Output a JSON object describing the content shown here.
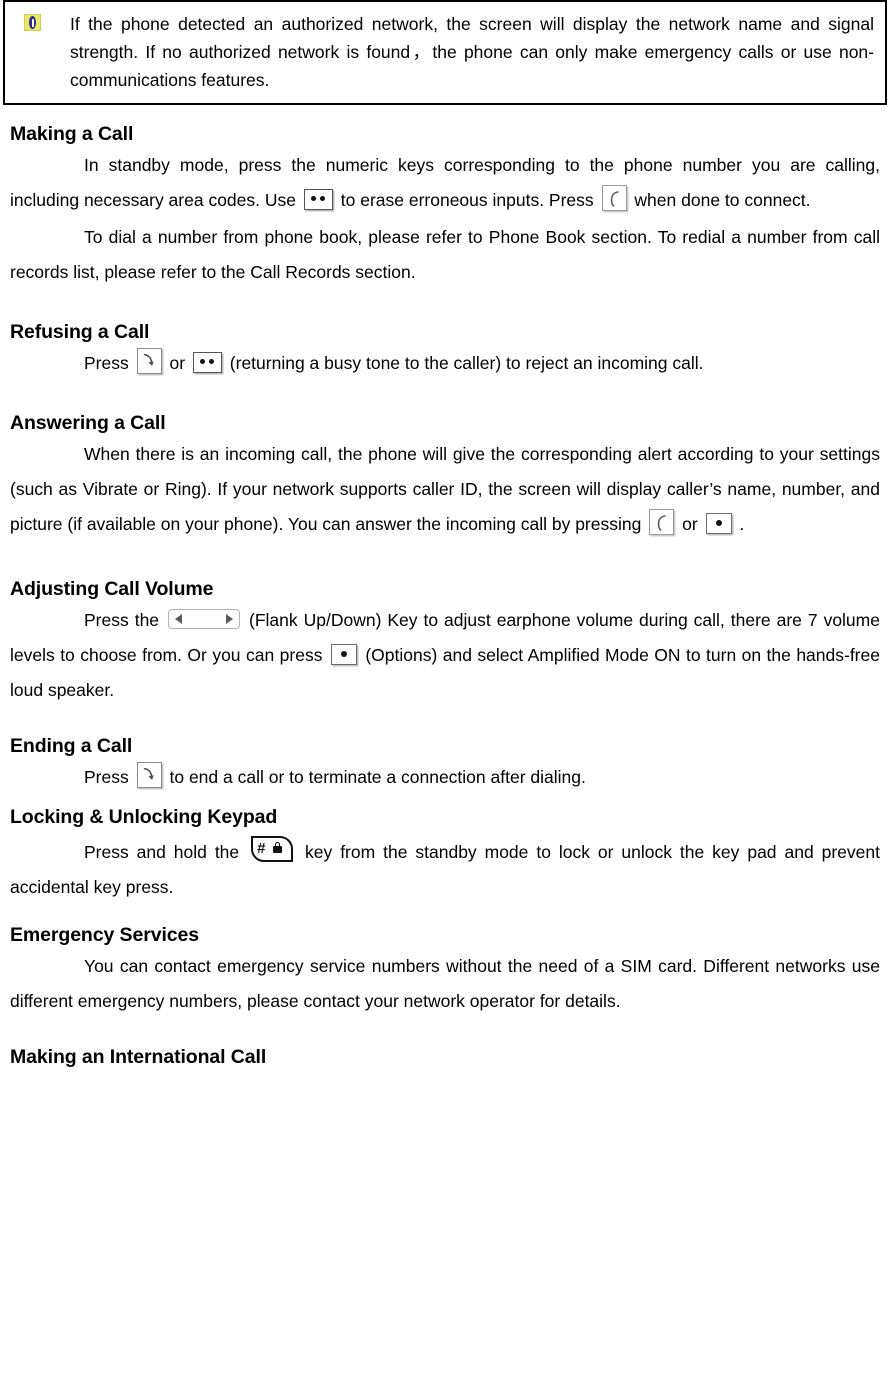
{
  "note": {
    "icon": "info-note-icon",
    "text": "If the phone detected an authorized network, the screen will display the network name and signal strength. If no authorized network is found，the phone can only make emergency calls or use non-communications features."
  },
  "sections": [
    {
      "id": "making-a-call",
      "title": "Making a Call",
      "paragraphs": [
        {
          "segments": [
            {
              "type": "text",
              "value": "In standby mode, press the numeric keys corresponding to the phone number you are calling, including necessary area codes. Use "
            },
            {
              "type": "icon",
              "value": "clear-key-icon"
            },
            {
              "type": "text",
              "value": " to erase erroneous inputs. Press "
            },
            {
              "type": "icon",
              "value": "send-key-icon"
            },
            {
              "type": "text",
              "value": " when done to connect."
            }
          ]
        },
        {
          "segments": [
            {
              "type": "text",
              "value": "To dial a number from phone book, please refer to Phone Book section. To redial a number from call records list, please refer to the Call Records section."
            }
          ]
        }
      ]
    },
    {
      "id": "refusing-a-call",
      "title": "Refusing a Call",
      "paragraphs": [
        {
          "segments": [
            {
              "type": "text",
              "value": "Press "
            },
            {
              "type": "icon",
              "value": "end-key-icon"
            },
            {
              "type": "text",
              "value": " or "
            },
            {
              "type": "icon",
              "value": "clear-key-icon"
            },
            {
              "type": "text",
              "value": " (returning a busy tone to the caller) to reject an incoming call."
            }
          ]
        }
      ]
    },
    {
      "id": "answering-a-call",
      "title": "Answering a Call",
      "paragraphs": [
        {
          "segments": [
            {
              "type": "text",
              "value": "When there is an incoming call, the phone will give the corresponding alert according to your settings (such as Vibrate or Ring). If your network supports caller ID, the screen will display caller’s name, number, and picture (if available on your phone). You can answer the incoming call by pressing "
            },
            {
              "type": "icon",
              "value": "send-key-icon"
            },
            {
              "type": "text",
              "value": " or "
            },
            {
              "type": "icon",
              "value": "soft-key-icon"
            },
            {
              "type": "text",
              "value": "."
            }
          ]
        }
      ]
    },
    {
      "id": "adjusting-call-volume",
      "title": "Adjusting Call Volume",
      "paragraphs": [
        {
          "segments": [
            {
              "type": "text",
              "value": "Press the "
            },
            {
              "type": "icon",
              "value": "flank-key-icon"
            },
            {
              "type": "text",
              "value": " (Flank Up/Down) Key to adjust earphone volume during call, there are 7 volume levels to choose from. Or you can press "
            },
            {
              "type": "icon",
              "value": "soft-key-icon"
            },
            {
              "type": "text",
              "value": " (Options) and select Amplified Mode ON to turn on the hands-free loud speaker."
            }
          ]
        }
      ]
    },
    {
      "id": "ending-a-call",
      "title": "Ending a Call",
      "paragraphs": [
        {
          "segments": [
            {
              "type": "text",
              "value": "Press "
            },
            {
              "type": "icon",
              "value": "end-key-icon"
            },
            {
              "type": "text",
              "value": " to end a call or to terminate a connection after dialing."
            }
          ]
        }
      ]
    },
    {
      "id": "locking-unlocking-keypad",
      "title": "Locking & Unlocking Keypad",
      "paragraphs": [
        {
          "segments": [
            {
              "type": "text",
              "value": "Press and hold the "
            },
            {
              "type": "icon",
              "value": "hash-lock-key-icon"
            },
            {
              "type": "text",
              "value": " key from the standby mode to lock or unlock the key pad and prevent accidental key press."
            }
          ]
        }
      ]
    },
    {
      "id": "emergency-services",
      "title": "Emergency Services",
      "paragraphs": [
        {
          "segments": [
            {
              "type": "text",
              "value": "You can contact emergency service numbers without the need of a SIM card. Different networks use different emergency numbers, please contact your network operator for details."
            }
          ]
        }
      ]
    },
    {
      "id": "making-an-international-call",
      "title": "Making an International Call",
      "paragraphs": []
    }
  ],
  "text": {
    "making_a_call_title": "Making a Call",
    "making_a_call_p1_a": "In standby mode, press the numeric keys corresponding to the phone number you are calling, including necessary area codes. Use",
    "making_a_call_p1_b": "to erase erroneous inputs. Press",
    "making_a_call_p1_c": "when done to connect.",
    "making_a_call_p2": "To dial a number from phone book, please refer to Phone Book section. To redial a number from call records list, please refer to the Call Records section.",
    "refusing_a_call_title": "Refusing a Call",
    "refusing_a_call_p1_a": "Press",
    "refusing_a_call_p1_b": "or",
    "refusing_a_call_p1_c": "(returning a busy tone to the caller) to reject an incoming call.",
    "answering_a_call_title": "Answering a Call",
    "answering_a_call_p1_a": "When there is an incoming call, the phone will give the corresponding alert according to your settings (such as Vibrate or Ring). If your network supports caller ID, the screen will display caller’s name, number, and picture (if available on your phone). You can answer the incoming call by pressing",
    "answering_a_call_p1_b": "or",
    "answering_a_call_p1_c": ".",
    "adjusting_call_volume_title": "Adjusting Call Volume",
    "adjusting_call_volume_p1_a": "Press the",
    "adjusting_call_volume_p1_b": "(Flank Up/Down) Key to adjust earphone volume during call, there are 7 volume levels to choose from. Or you can press",
    "adjusting_call_volume_p1_c": "(Options) and select Amplified Mode ON to turn on the hands-free loud speaker.",
    "ending_a_call_title": "Ending a Call",
    "ending_a_call_p1_a": "Press",
    "ending_a_call_p1_b": "to end a call or to terminate a connection after dialing.",
    "locking_title": "Locking & Unlocking Keypad",
    "locking_p1_a": "Press and hold the",
    "locking_p1_b": "key from the standby mode to lock or unlock the key pad and prevent accidental key press.",
    "emergency_title": "Emergency Services",
    "emergency_p1": "You can contact emergency service numbers without the need of a SIM card. Different networks use different emergency numbers, please contact your network operator for details.",
    "international_title": "Making an International Call"
  },
  "colors": {
    "page_background": "#ffffff",
    "text": "#000000",
    "note_border": "#000000",
    "note_icon_background": "#e8e86a",
    "note_icon_mark": "#2b2b8f"
  }
}
